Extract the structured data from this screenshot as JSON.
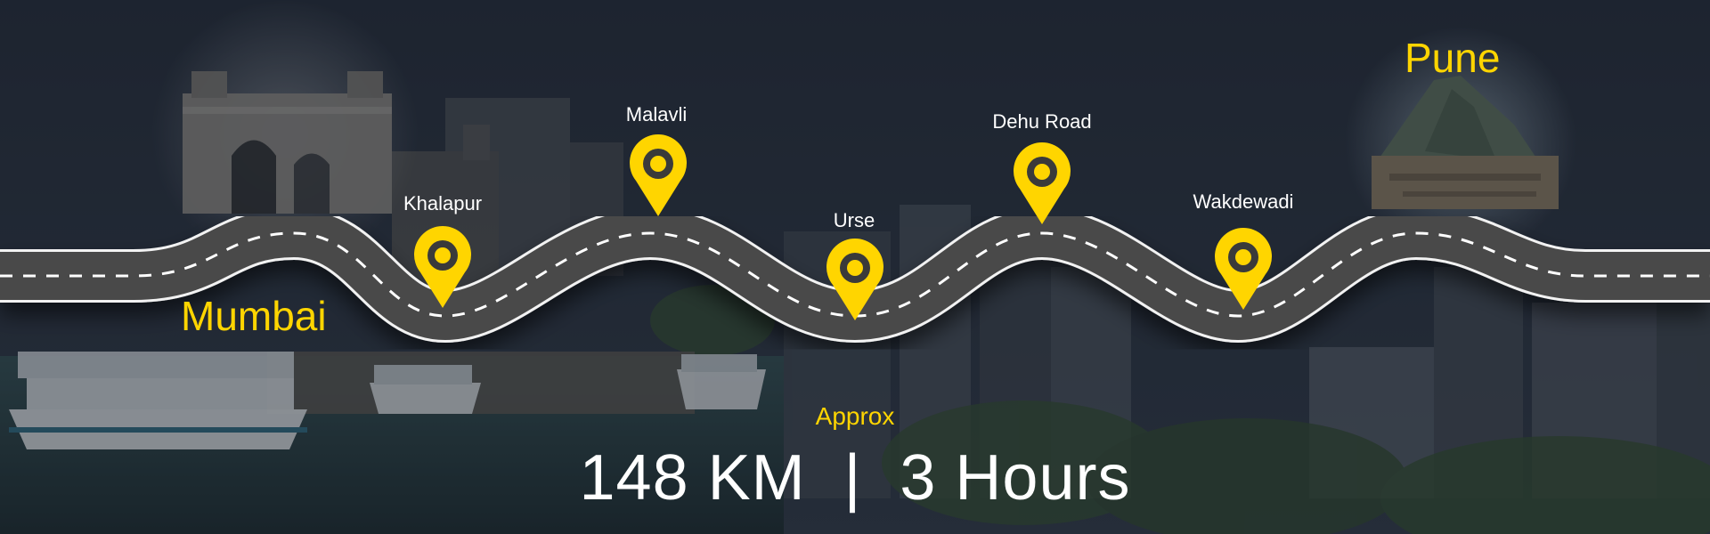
{
  "origin": "Mumbai",
  "destination": "Pune",
  "stops": [
    {
      "name": "Khalapur"
    },
    {
      "name": "Malavli"
    },
    {
      "name": "Urse"
    },
    {
      "name": "Dehu Road"
    },
    {
      "name": "Wakdewadi"
    }
  ],
  "approx_label": "Approx",
  "summary": {
    "distance": "148 KM",
    "separator": "|",
    "duration": "3 Hours"
  },
  "colors": {
    "accent": "#ffd500",
    "road": "#4a4a4a",
    "road_edge": "#ffffff",
    "overlay": "#1e2530"
  },
  "icons": {
    "stop_marker": "map-pin-icon"
  }
}
